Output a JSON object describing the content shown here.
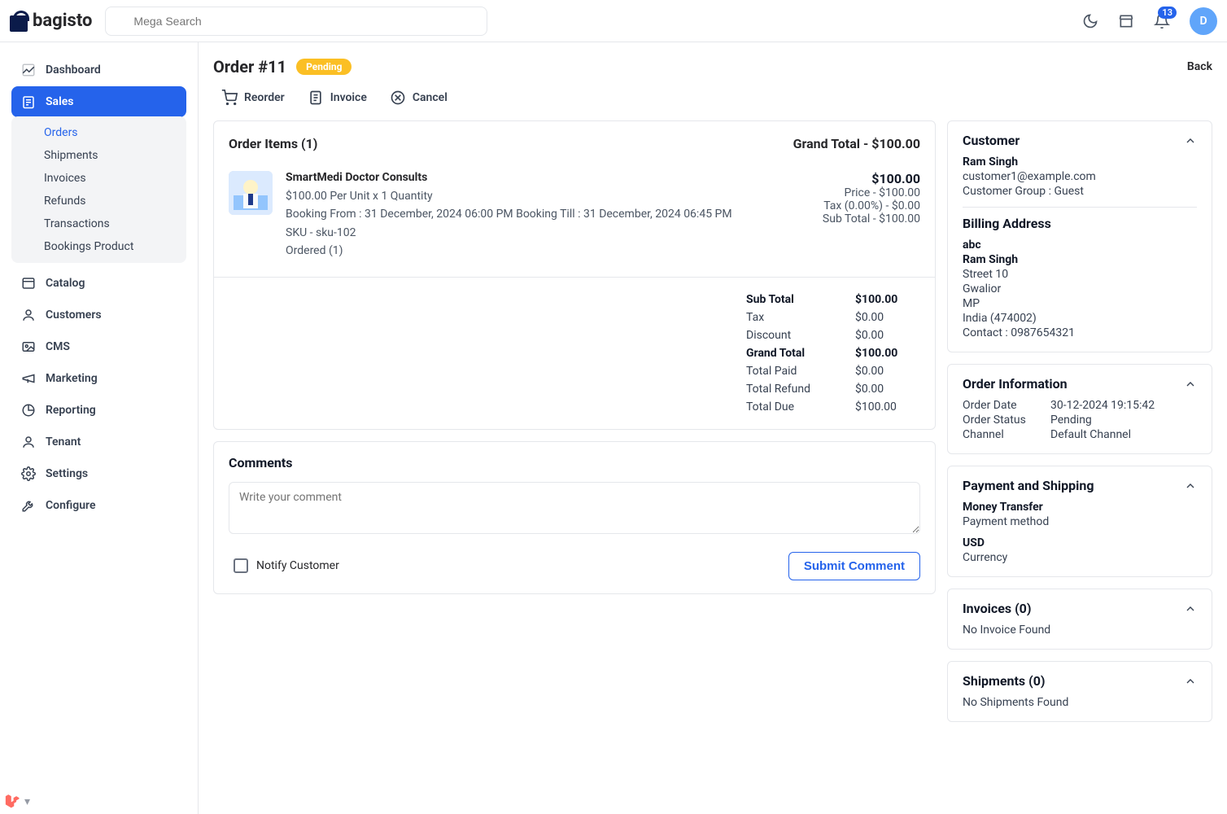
{
  "brand": "bagisto",
  "search": {
    "placeholder": "Mega Search"
  },
  "notifications": {
    "count": "13"
  },
  "avatar_initial": "D",
  "nav": {
    "dashboard": "Dashboard",
    "sales": "Sales",
    "sales_sub": {
      "orders": "Orders",
      "shipments": "Shipments",
      "invoices": "Invoices",
      "refunds": "Refunds",
      "transactions": "Transactions",
      "bookings": "Bookings Product"
    },
    "catalog": "Catalog",
    "customers": "Customers",
    "cms": "CMS",
    "marketing": "Marketing",
    "reporting": "Reporting",
    "tenant": "Tenant",
    "settings": "Settings",
    "configure": "Configure"
  },
  "page": {
    "title": "Order #11",
    "status": "Pending",
    "back": "Back",
    "actions": {
      "reorder": "Reorder",
      "invoice": "Invoice",
      "cancel": "Cancel"
    }
  },
  "items": {
    "header": "Order Items (1)",
    "grand_total_label": "Grand Total - $100.00",
    "line": {
      "title": "SmartMedi Doctor Consults",
      "unit": "$100.00 Per Unit x 1 Quantity",
      "booking": "Booking From : 31 December, 2024 06:00 PM Booking Till : 31 December, 2024 06:45 PM",
      "sku": "SKU - sku-102",
      "ordered": "Ordered (1)",
      "amount": "$100.00",
      "price": "Price - $100.00",
      "tax": "Tax (0.00%) - $0.00",
      "subtotal": "Sub Total - $100.00"
    }
  },
  "totals": {
    "sub_total_l": "Sub Total",
    "sub_total_v": "$100.00",
    "tax_l": "Tax",
    "tax_v": "$0.00",
    "discount_l": "Discount",
    "discount_v": "$0.00",
    "grand_l": "Grand Total",
    "grand_v": "$100.00",
    "paid_l": "Total Paid",
    "paid_v": "$0.00",
    "refund_l": "Total Refund",
    "refund_v": "$0.00",
    "due_l": "Total Due",
    "due_v": "$100.00"
  },
  "comments": {
    "title": "Comments",
    "placeholder": "Write your comment",
    "notify": "Notify Customer",
    "submit": "Submit Comment"
  },
  "customer": {
    "title": "Customer",
    "name": "Ram Singh",
    "email": "customer1@example.com",
    "group": "Customer Group : Guest",
    "billing_title": "Billing Address",
    "b_line1": "abc",
    "b_line2": "Ram Singh",
    "b_street": "Street 10",
    "b_city": "Gwalior",
    "b_state": "MP",
    "b_country": "India (474002)",
    "b_contact": "Contact : 0987654321"
  },
  "order_info": {
    "title": "Order Information",
    "date_l": "Order Date",
    "date_v": "30-12-2024 19:15:42",
    "status_l": "Order Status",
    "status_v": "Pending",
    "channel_l": "Channel",
    "channel_v": "Default Channel"
  },
  "payship": {
    "title": "Payment and Shipping",
    "method": "Money Transfer",
    "method_label": "Payment method",
    "currency": "USD",
    "currency_label": "Currency"
  },
  "invoices": {
    "title": "Invoices (0)",
    "empty": "No Invoice Found"
  },
  "shipments": {
    "title": "Shipments (0)",
    "empty": "No Shipments Found"
  }
}
